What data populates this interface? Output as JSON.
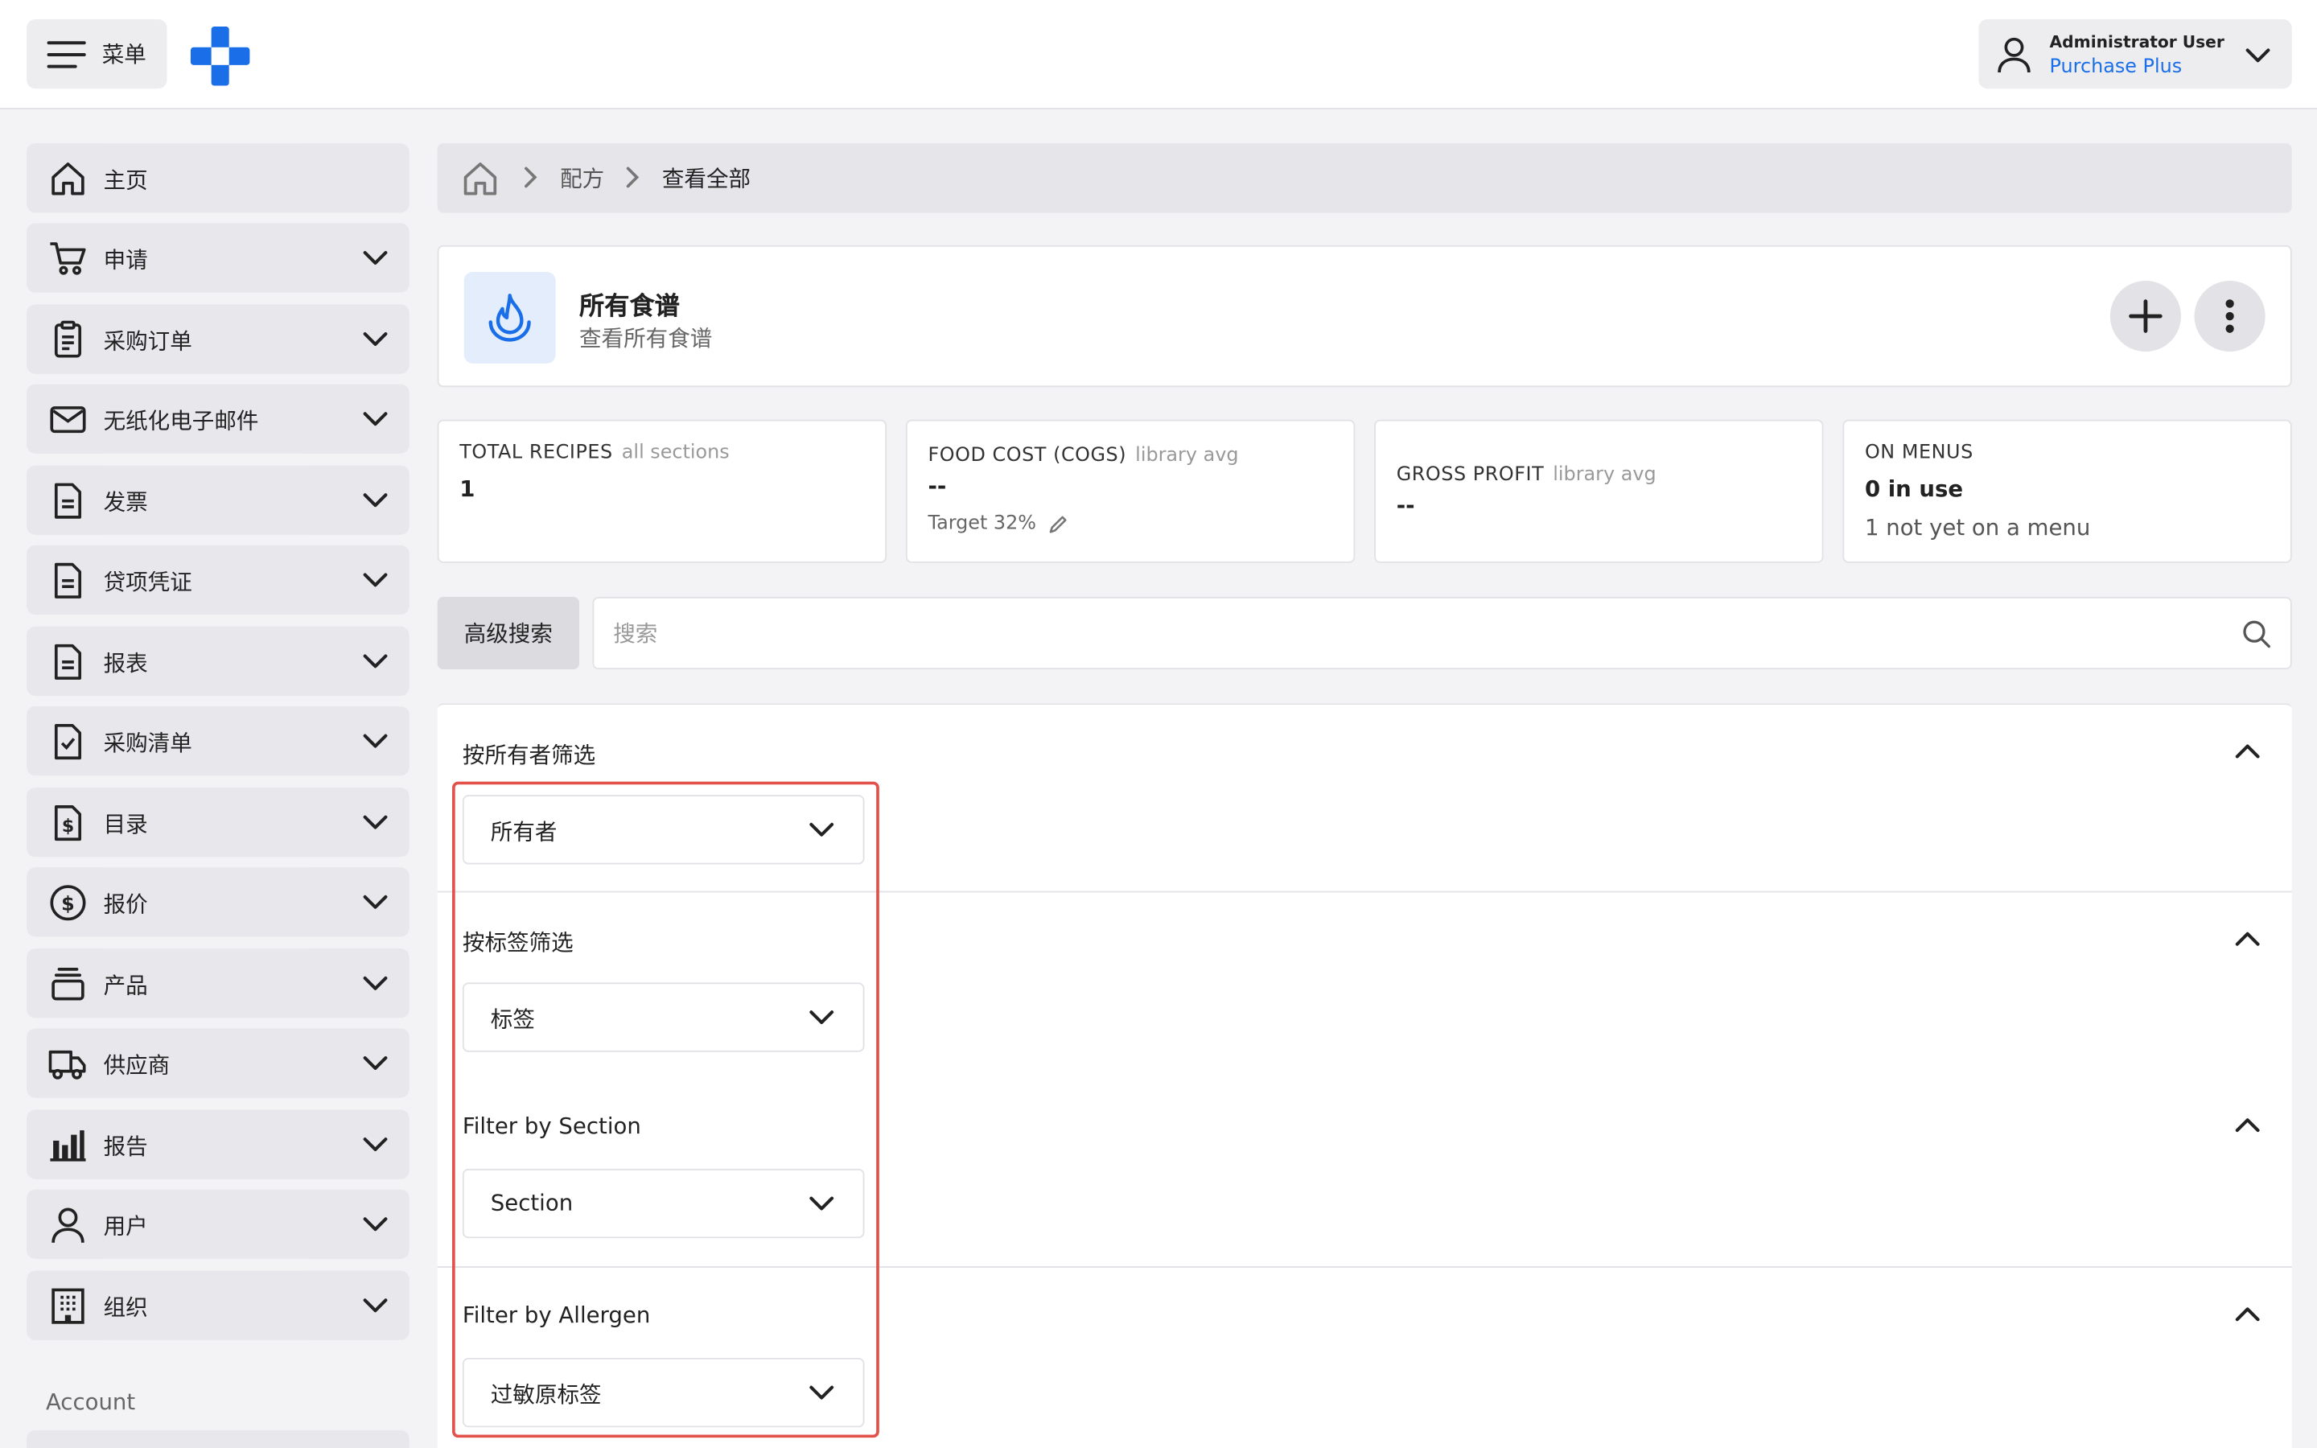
{
  "header": {
    "menu_label": "菜单",
    "user_name": "Administrator User",
    "user_org": "Purchase Plus"
  },
  "sidebar": {
    "items": [
      {
        "label": "主页",
        "icon": "home-icon"
      },
      {
        "label": "申请",
        "icon": "cart-icon"
      },
      {
        "label": "采购订单",
        "icon": "clipboard-icon"
      },
      {
        "label": "无纸化电子邮件",
        "icon": "envelope-icon"
      },
      {
        "label": "发票",
        "icon": "document-icon"
      },
      {
        "label": "贷项凭证",
        "icon": "document-icon"
      },
      {
        "label": "报表",
        "icon": "document-icon"
      },
      {
        "label": "采购清单",
        "icon": "checklist-icon"
      },
      {
        "label": "目录",
        "icon": "catalog-dollar-icon"
      },
      {
        "label": "报价",
        "icon": "dollar-circle-icon"
      },
      {
        "label": "产品",
        "icon": "products-stack-icon"
      },
      {
        "label": "供应商",
        "icon": "truck-icon"
      },
      {
        "label": "报告",
        "icon": "bar-chart-icon"
      },
      {
        "label": "用户",
        "icon": "user-icon"
      },
      {
        "label": "组织",
        "icon": "building-icon"
      }
    ],
    "section_account": "Account"
  },
  "breadcrumb": {
    "items": [
      "配方",
      "查看全部"
    ]
  },
  "page": {
    "title": "所有食谱",
    "subtitle": "查看所有食谱",
    "icon": "flame-icon"
  },
  "stats": {
    "total_recipes": {
      "label": "TOTAL RECIPES",
      "sub": "all sections",
      "value": "1"
    },
    "food_cost": {
      "label": "FOOD COST (COGS)",
      "sub": "library avg",
      "value": "--",
      "note": "Target 32%"
    },
    "gross_profit": {
      "label": "GROSS PROFIT",
      "sub": "library avg",
      "value": "--"
    },
    "on_menus": {
      "label": "ON MENUS",
      "value": "0 in use",
      "note": "1 not yet on a menu"
    }
  },
  "search": {
    "advanced_label": "高级搜索",
    "placeholder": "搜索"
  },
  "filters": [
    {
      "title": "按所有者筛选",
      "value": "所有者"
    },
    {
      "title": "按标签筛选",
      "value": "标签"
    },
    {
      "title": "Filter by Section",
      "value": "Section"
    },
    {
      "title": "Filter by Allergen",
      "value": "过敏原标签"
    }
  ],
  "colors": {
    "accent": "#1a6fe8",
    "highlight": "#e3524a"
  }
}
